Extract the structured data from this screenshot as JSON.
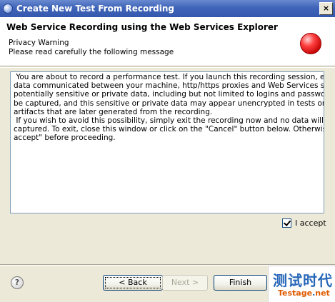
{
  "window": {
    "title": "Create New Test From Recording",
    "close_glyph": "×"
  },
  "header": {
    "title": "Web Service Recording using the Web Services Explorer",
    "line1": "Privacy Warning",
    "line2": "Please read carefully the following message",
    "status_icon": "error-circle-icon",
    "status_color": "#e00000"
  },
  "message": {
    "text": " You are about to record a performance test. If you launch this recording session, electroni\ndata communicated between your machine, http/https proxies and Web Services servers --\npotentially sensitive or private data, including but not limited to logins and passwords -- will\nbe captured, and this sensitive or private data may appear unencrypted in tests or other\nartifacts that are later generated from the recording.\n If you wish to avoid this possibility, simply exit the recording now and no data will be\ncaptured. To exit, close this window or click on the \"Cancel\" button below. Otherwise, click \"\naccept\" before proceeding."
  },
  "accept": {
    "label": "I accept",
    "checked": true
  },
  "buttons": {
    "help_glyph": "?",
    "back_label": "< Back",
    "next_label": "Next >",
    "finish_label": "Finish"
  },
  "watermark": {
    "cn": "测试时代",
    "en_part1": "Testage",
    "en_dot": ".",
    "en_part2": "net"
  }
}
